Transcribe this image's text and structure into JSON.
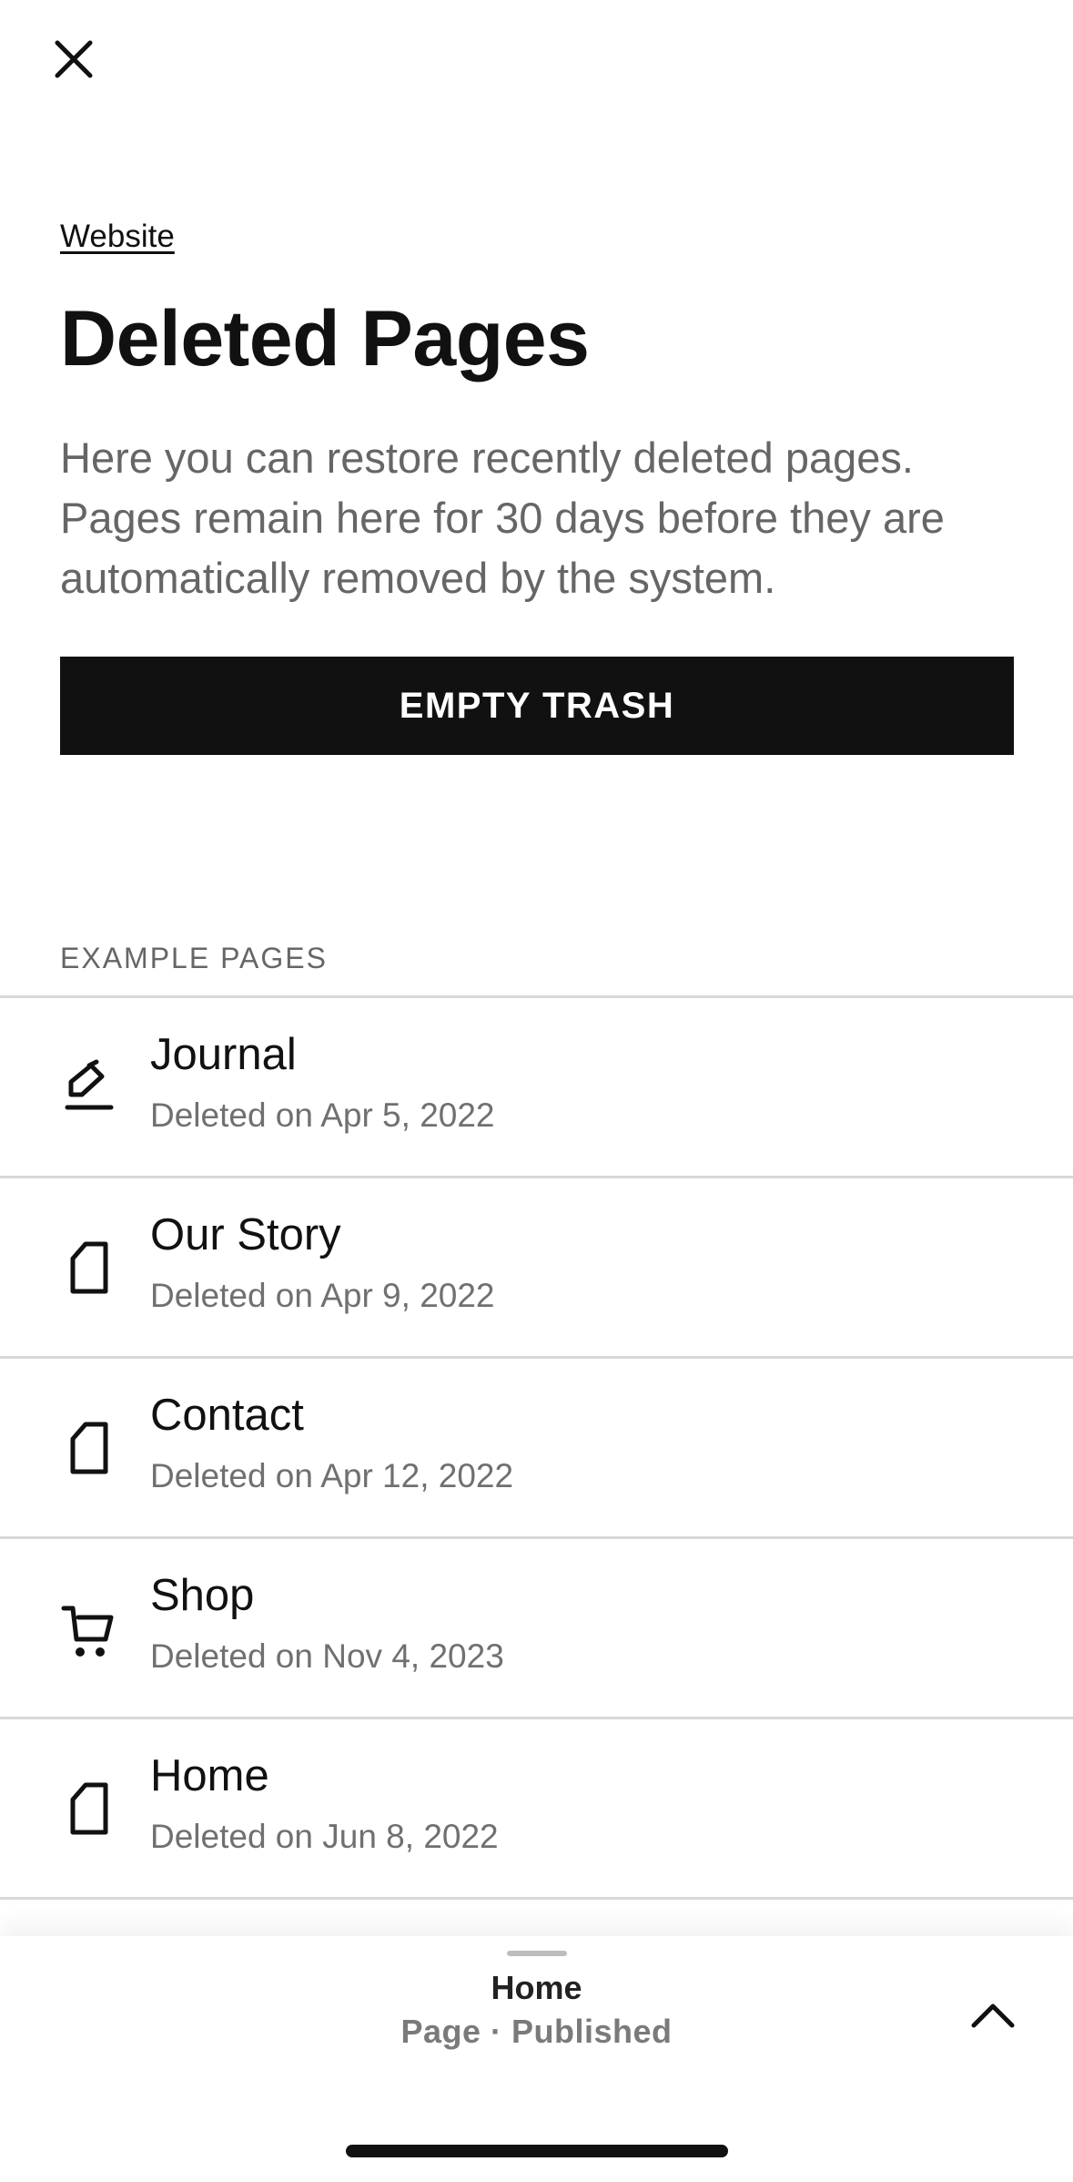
{
  "header": {
    "close_icon": "close-icon",
    "breadcrumb": "Website",
    "title": "Deleted Pages",
    "description": "Here you can restore recently deleted pages. Pages remain here for 30 days before they are automatically removed by the system."
  },
  "actions": {
    "empty_trash_label": "EMPTY TRASH"
  },
  "section": {
    "label": "EXAMPLE PAGES"
  },
  "pages": [
    {
      "title": "Journal",
      "deleted": "Deleted on Apr 5, 2022",
      "icon": "blog-edit-icon"
    },
    {
      "title": "Our Story",
      "deleted": "Deleted on Apr 9, 2022",
      "icon": "page-icon"
    },
    {
      "title": "Contact",
      "deleted": "Deleted on Apr 12, 2022",
      "icon": "page-icon"
    },
    {
      "title": "Shop",
      "deleted": "Deleted on Nov 4, 2023",
      "icon": "cart-icon"
    },
    {
      "title": "Home",
      "deleted": "Deleted on Jun 8, 2022",
      "icon": "page-icon"
    }
  ],
  "bottom_panel": {
    "title": "Home",
    "subtitle": "Page · Published",
    "expand_icon": "chevron-up-icon"
  },
  "colors": {
    "button_bg": "#111111",
    "button_text": "#ffffff",
    "muted_text": "#666666",
    "divider": "#d8d8d8"
  }
}
